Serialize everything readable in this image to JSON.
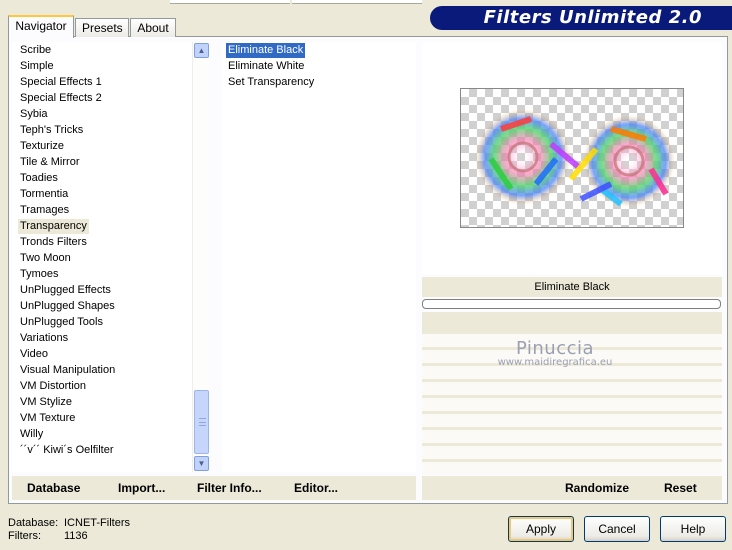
{
  "tabs": [
    {
      "label": "Navigator"
    },
    {
      "label": "Presets"
    },
    {
      "label": "About"
    }
  ],
  "banner": {
    "title": "Filters Unlimited 2.0"
  },
  "categories": [
    "Scribe",
    "Simple",
    "Special Effects 1",
    "Special Effects 2",
    "Sybia",
    "Teph's Tricks",
    "Texturize",
    "Tile & Mirror",
    "Toadies",
    "Tormentia",
    "Tramages",
    "Transparency",
    "Tronds Filters",
    "Two Moon",
    "Tymoes",
    "UnPlugged Effects",
    "UnPlugged Shapes",
    "UnPlugged Tools",
    "Variations",
    "Video",
    "Visual Manipulation",
    "VM Distortion",
    "VM Stylize",
    "VM Texture",
    "Willy",
    "´´v´´ Kiwi´s Oelfilter"
  ],
  "selected_category": "Transparency",
  "filters": [
    "Eliminate Black",
    "Eliminate White",
    "Set Transparency"
  ],
  "selected_filter": "Eliminate Black",
  "preview": {
    "filter_name": "Eliminate Black"
  },
  "watermark": {
    "line1": "Pinuccia",
    "line2": "www.maidiregrafica.eu"
  },
  "left_buttons": {
    "database": "Database",
    "import": "Import...",
    "filter_info": "Filter Info...",
    "editor": "Editor..."
  },
  "right_buttons": {
    "randomize": "Randomize",
    "reset": "Reset"
  },
  "status": {
    "database_label": "Database:",
    "database_value": "ICNET-Filters",
    "filters_label": "Filters:",
    "filters_value": "1136"
  },
  "dialog": {
    "apply": "Apply",
    "cancel": "Cancel",
    "help": "Help"
  },
  "colors": {
    "banner": "#0a1a7a",
    "selection": "#316ac5",
    "face": "#ece9d8"
  }
}
